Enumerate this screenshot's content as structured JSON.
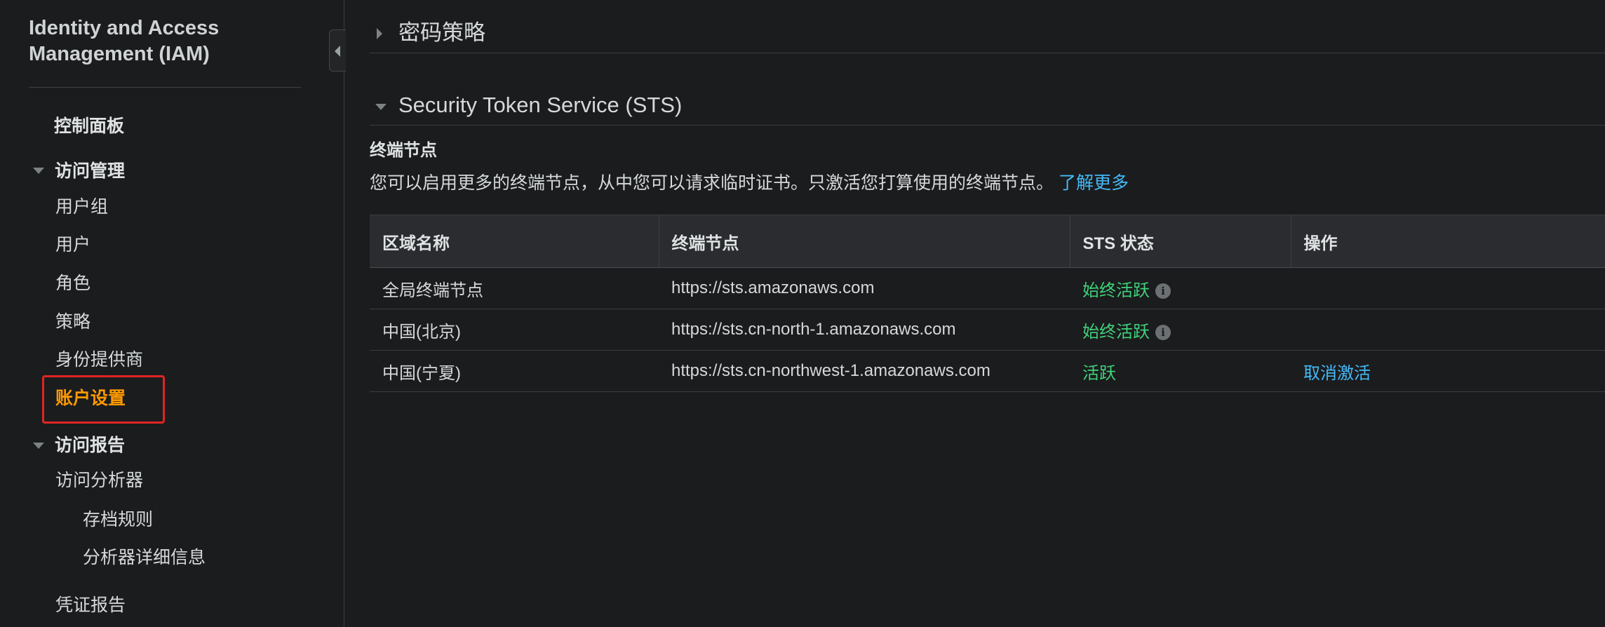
{
  "sidebar": {
    "title": "Identity and Access Management (IAM)",
    "dashboard": "控制面板",
    "access_management": {
      "label": "访问管理",
      "items": [
        "用户组",
        "用户",
        "角色",
        "策略",
        "身份提供商",
        "账户设置"
      ],
      "active": "账户设置"
    },
    "access_reports": {
      "label": "访问报告",
      "analyzer": "访问分析器",
      "analyzer_children": [
        "存档规则",
        "分析器详细信息"
      ],
      "credential_report": "凭证报告"
    }
  },
  "main": {
    "password_policy": {
      "title": "密码策略"
    },
    "sts": {
      "title": "Security Token Service (STS)",
      "endpoints_heading": "终端节点",
      "description": "您可以启用更多的终端节点，从中您可以请求临时证书。只激活您打算使用的终端节点。",
      "learn_more": "了解更多",
      "table": {
        "headers": [
          "区域名称",
          "终端节点",
          "STS 状态",
          "操作"
        ],
        "rows": [
          {
            "region": "全局终端节点",
            "endpoint": "https://sts.amazonaws.com",
            "status": "始终活跃",
            "action": ""
          },
          {
            "region": "中国(北京)",
            "endpoint": "https://sts.cn-north-1.amazonaws.com",
            "status": "始终活跃",
            "action": ""
          },
          {
            "region": "中国(宁夏)",
            "endpoint": "https://sts.cn-northwest-1.amazonaws.com",
            "status": "活跃",
            "action": "取消激活"
          }
        ]
      }
    }
  },
  "colors": {
    "accent_active": "#ff9900",
    "link": "#44b9f7",
    "status_green": "#3fd27a",
    "highlight_box": "#e02424"
  },
  "icons": {
    "info": "info-icon",
    "collapse": "collapse-arrow-icon"
  }
}
